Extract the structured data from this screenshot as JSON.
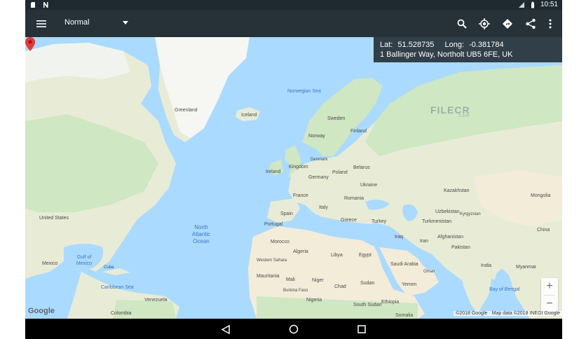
{
  "status_bar": {
    "time": "10:51"
  },
  "app_bar": {
    "map_type": "Normal"
  },
  "location": {
    "lat_label": "Lat:",
    "lat_value": "51.528735",
    "long_label": "Long:",
    "long_value": "-0.381784",
    "address": "1 Ballinger Way, Northolt UB5 6FE, UK"
  },
  "map_labels": {
    "greenland": "Greenland",
    "iceland": "Iceland",
    "norwegian_sea": "Norwegian Sea",
    "sweden": "Sweden",
    "finland": "Finland",
    "norway": "Norway",
    "denmark": "Denmark",
    "ireland": "Ireland",
    "uk": "Kingdom",
    "belarus": "Belarus",
    "poland": "Poland",
    "germany": "Germany",
    "ukraine": "Ukraine",
    "france": "France",
    "romania": "Romania",
    "kazakhstan": "Kazakhstan",
    "mongolia": "Mongolia",
    "spain": "Spain",
    "portugal": "Portugal",
    "italy": "Italy",
    "greece": "Greece",
    "turkey": "Turkey",
    "uzbekistan": "Uzbekistan",
    "turkmenistan": "Turkmenistan",
    "kyrgyzstan": "Kyrgyzstan",
    "china": "China",
    "afghanistan": "Afghanistan",
    "iran": "Iran",
    "iraq": "Iraq",
    "pakistan": "Pakistan",
    "india": "India",
    "myanmar": "Myanmar",
    "bay_of_bengal": "Bay of Bengal",
    "morocco": "Morocco",
    "algeria": "Algeria",
    "libya": "Libya",
    "egypt": "Egypt",
    "saudi_arabia": "Saudi Arabia",
    "oman": "Oman",
    "yemen": "Yemen",
    "western_sahara": "Western Sahara",
    "mauritania": "Mauritania",
    "mali": "Mali",
    "niger": "Niger",
    "chad": "Chad",
    "sudan": "Sudan",
    "burkina_faso": "Burkina Faso",
    "nigeria": "Nigeria",
    "ethiopia": "Ethiopia",
    "south_sudan": "South Sudan",
    "somalia": "Somalia",
    "united_states": "United States",
    "north_atlantic_ocean": "North Atlantic Ocean",
    "gulf_of_mexico": "Gulf of Mexico",
    "mexico": "Mexico",
    "cuba": "Cuba",
    "caribbean_sea": "Caribbean Sea",
    "venezuela": "Venezuela",
    "colombia": "Colombia"
  },
  "zoom": {
    "in": "+",
    "out": "−"
  },
  "attribution": "©2018 Google · Map data ©2018 INEGI Google",
  "logo": "Google",
  "watermark": {
    "main": "FILECR",
    "sub": ".com"
  },
  "colors": {
    "app_bar": "#263238",
    "status_bar": "#1f2a30",
    "ocean": "#aadaff",
    "land": "#e8ecd6",
    "greenery": "#cfe7c2",
    "ice": "#f6f6f2",
    "desert": "#f3ecd9",
    "marker": "#e53935"
  }
}
